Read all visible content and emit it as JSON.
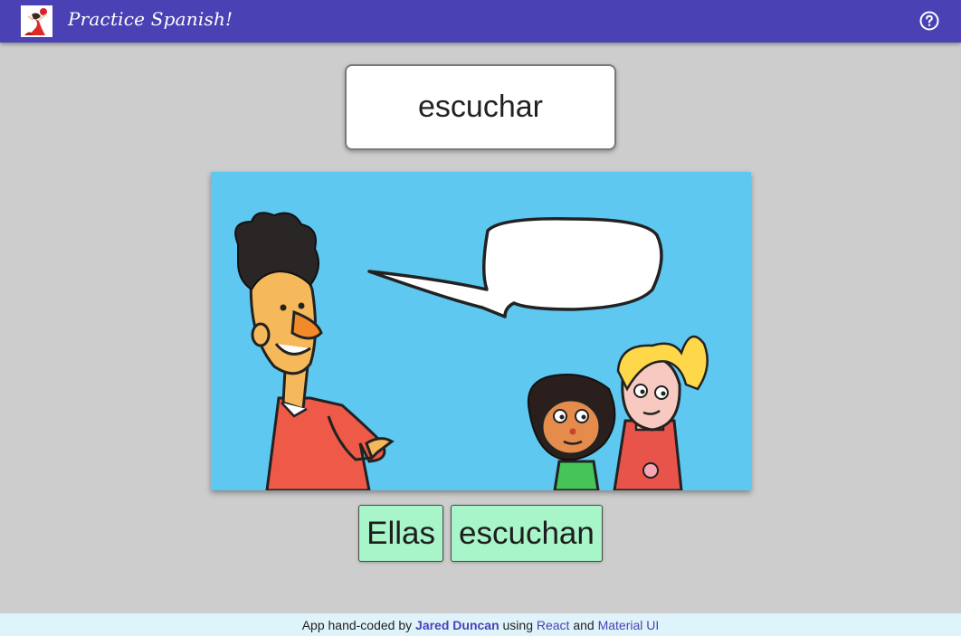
{
  "app": {
    "title": "Practice Spanish!"
  },
  "prompt": {
    "verb": "escuchar"
  },
  "answer": {
    "words": [
      "Ellas",
      "escuchan"
    ]
  },
  "footer": {
    "prefix": "App hand-coded by ",
    "author": "Jared Duncan",
    "using": " using ",
    "link1": "React",
    "and": " and ",
    "link2": "Material UI"
  },
  "icons": {
    "help": "help-circle-icon",
    "logo": "flamenco-dancer-icon"
  },
  "colors": {
    "appbar": "#4a42b4",
    "background": "#cdcdcd",
    "word_tile": "#a8f5c9",
    "footer": "#dff3fb",
    "scene_sky": "#5ec8f0"
  }
}
